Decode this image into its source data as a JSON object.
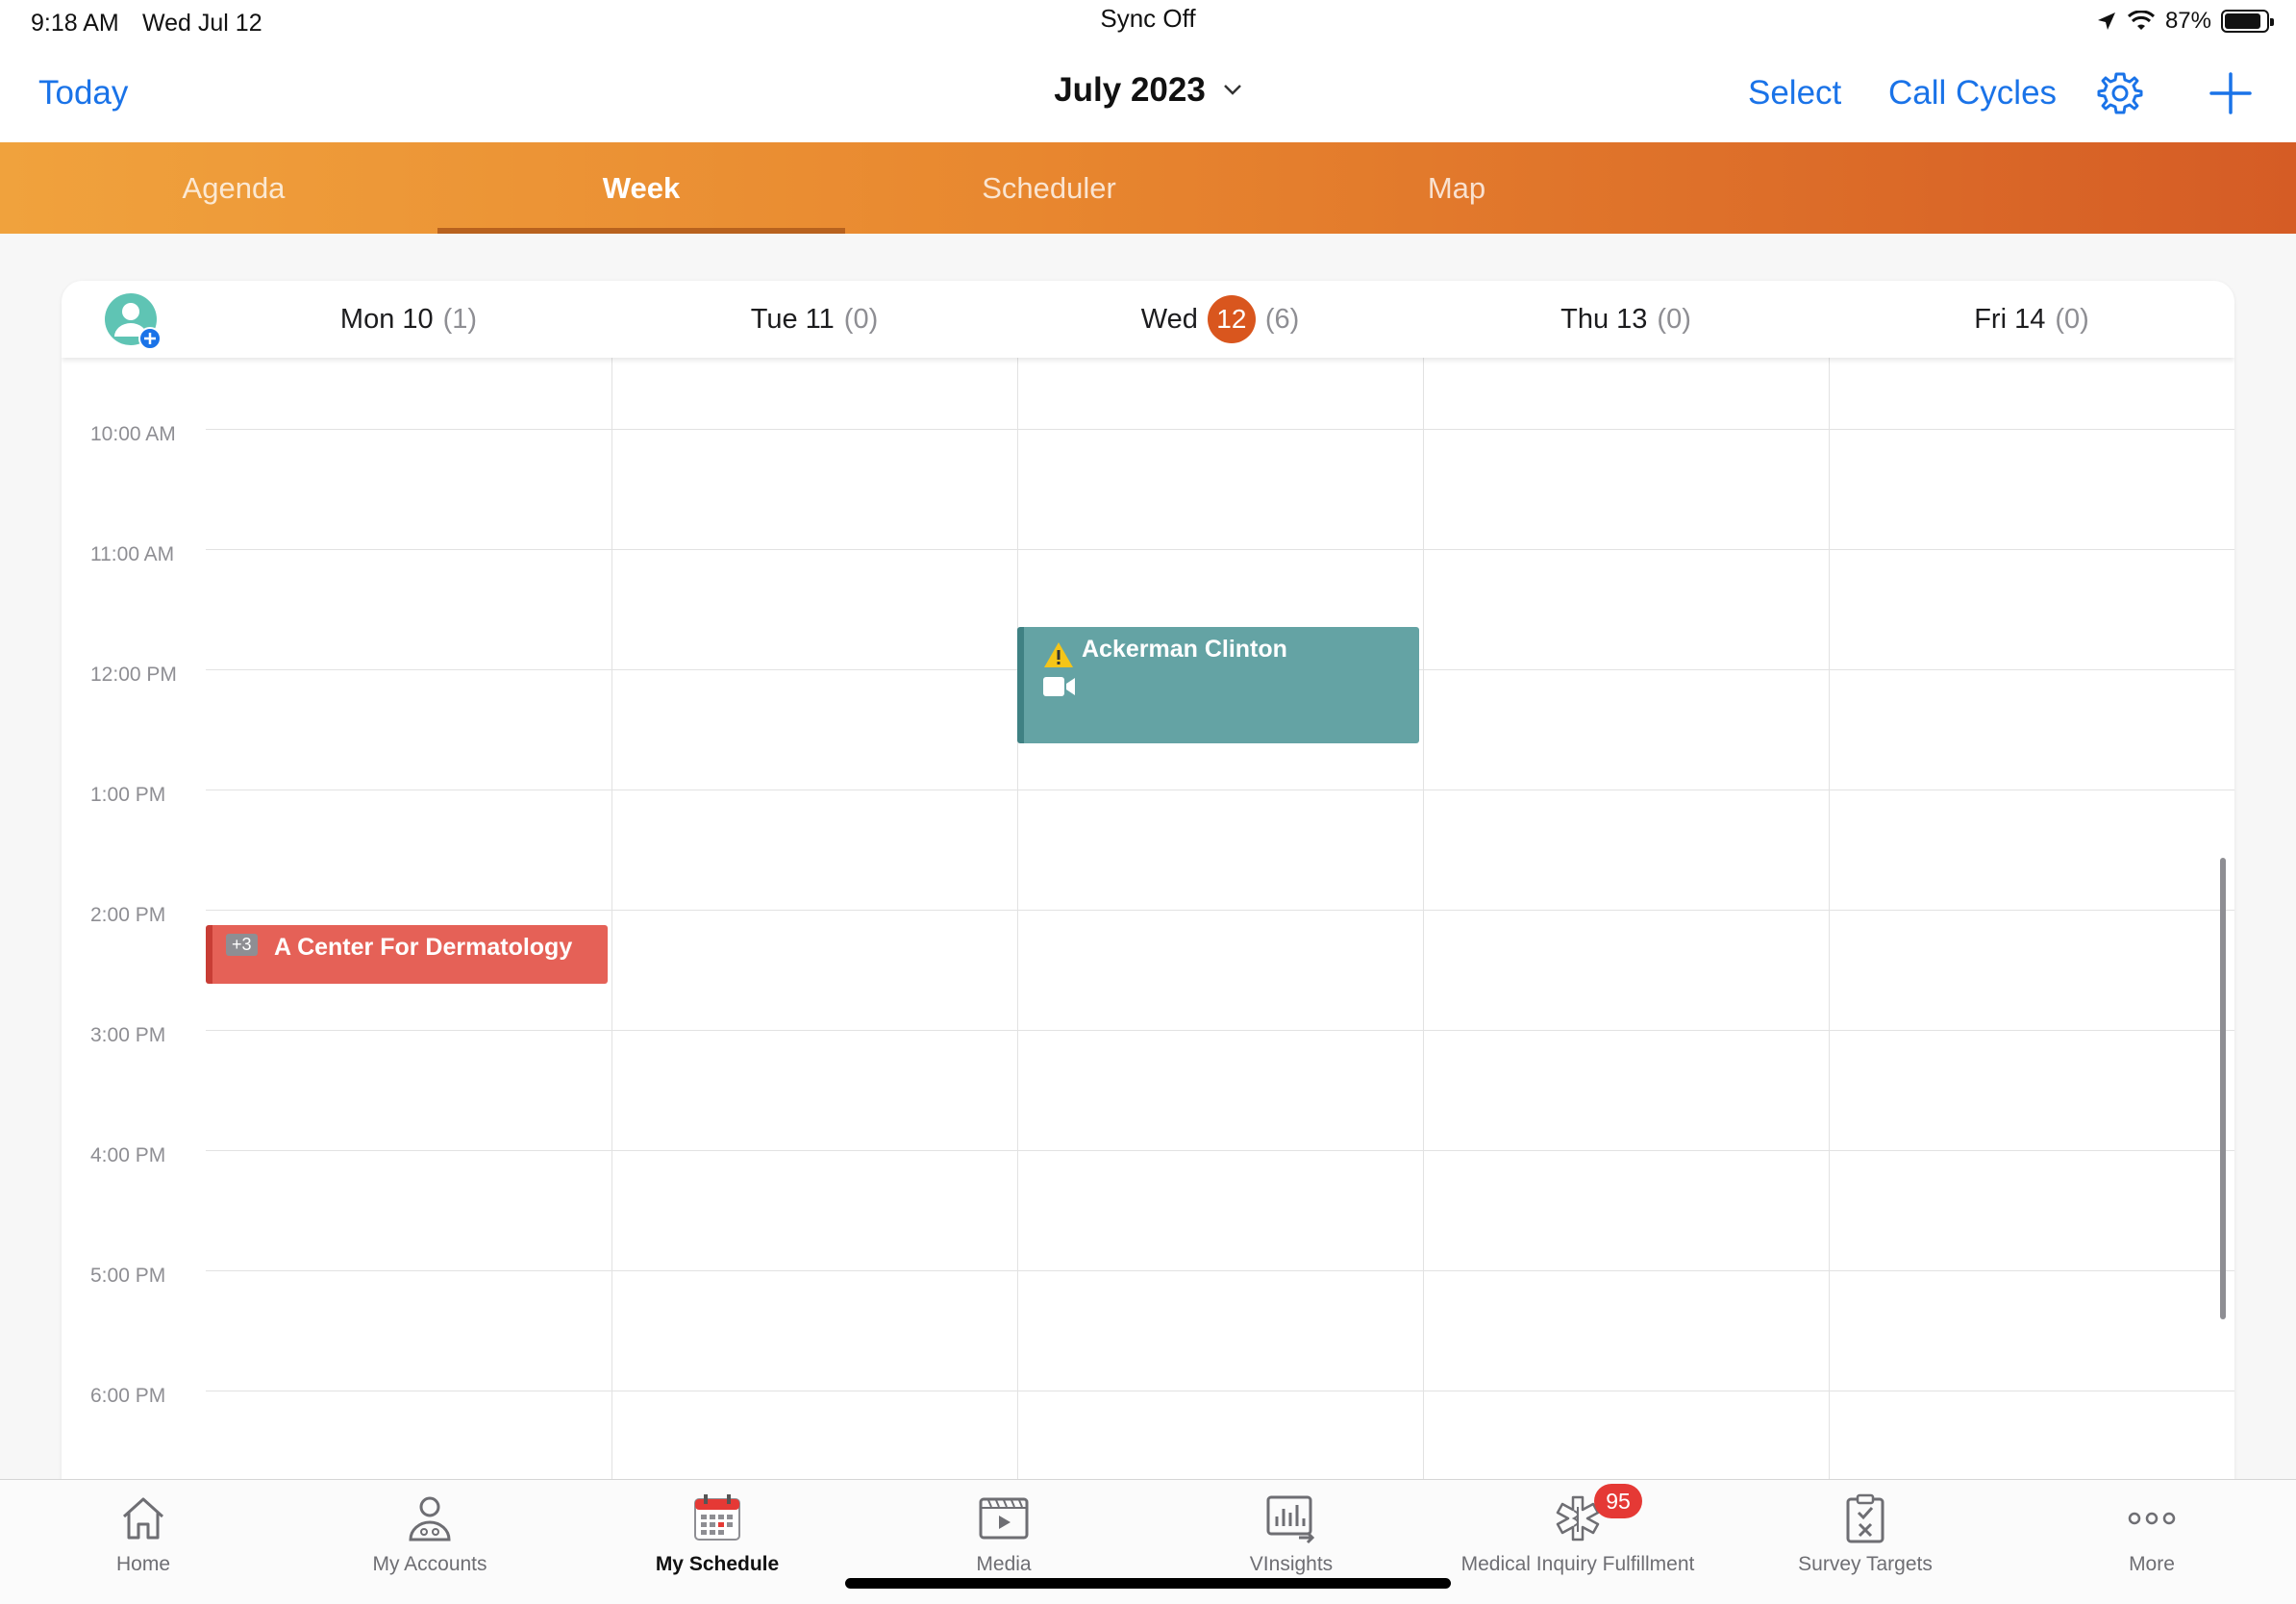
{
  "status_bar": {
    "time": "9:18 AM",
    "date": "Wed Jul 12",
    "center": "Sync Off",
    "battery": "87%"
  },
  "nav": {
    "today": "Today",
    "title": "July 2023",
    "select": "Select",
    "call_cycles": "Call Cycles"
  },
  "tabs": [
    {
      "label": "Agenda",
      "active": false
    },
    {
      "label": "Week",
      "active": true
    },
    {
      "label": "Scheduler",
      "active": false
    },
    {
      "label": "Map",
      "active": false
    }
  ],
  "days": [
    {
      "label": "Mon 10",
      "count": "(1)"
    },
    {
      "label": "Tue 11",
      "count": "(0)"
    },
    {
      "label": "Wed",
      "badge": "12",
      "count": "(6)"
    },
    {
      "label": "Thu 13",
      "count": "(0)"
    },
    {
      "label": "Fri 14",
      "count": "(0)"
    }
  ],
  "time_labels": [
    "10:00 AM",
    "11:00 AM",
    "12:00 PM",
    "1:00 PM",
    "2:00 PM",
    "3:00 PM",
    "4:00 PM",
    "5:00 PM",
    "6:00 PM"
  ],
  "events": {
    "dermatology": {
      "more": "+3",
      "title": "A Center For Dermatology",
      "color": "#e56157"
    },
    "ackerman": {
      "title": "Ackerman Clinton",
      "color": "#64a3a4"
    }
  },
  "bottom_tabs": [
    {
      "label": "Home",
      "icon": "home-icon"
    },
    {
      "label": "My Accounts",
      "icon": "person-icon"
    },
    {
      "label": "My Schedule",
      "icon": "calendar-icon",
      "active": true
    },
    {
      "label": "Media",
      "icon": "media-icon"
    },
    {
      "label": "VInsights",
      "icon": "chart-icon"
    },
    {
      "label": "Medical Inquiry Fulfillment",
      "icon": "medical-icon",
      "badge": "95"
    },
    {
      "label": "Survey Targets",
      "icon": "clipboard-icon"
    },
    {
      "label": "More",
      "icon": "more-icon"
    }
  ],
  "colors": {
    "accent": "#1a73e8",
    "today_badge": "#d9561e",
    "tab_gradient_start": "#f0a23d",
    "tab_gradient_end": "#d55c25"
  }
}
